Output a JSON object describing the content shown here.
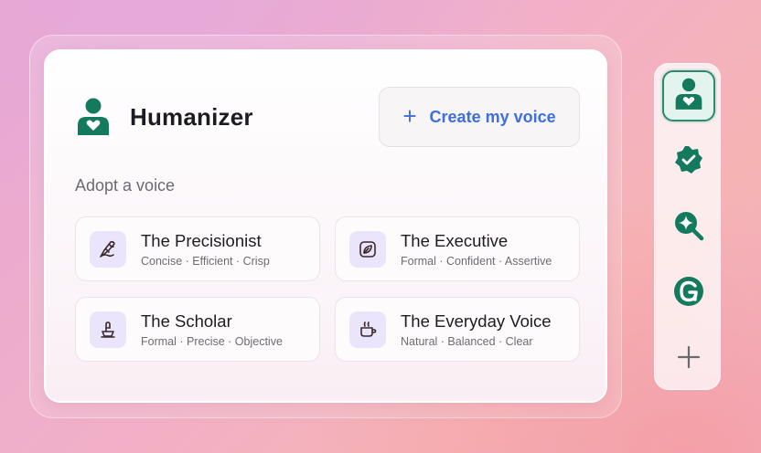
{
  "app": {
    "title": "Humanizer"
  },
  "create_button": {
    "label": "Create my voice"
  },
  "section": {
    "label": "Adopt a voice"
  },
  "voices": [
    {
      "title": "The Precisionist",
      "tags": "Concise · Efficient · Crisp",
      "icon": "pen-nib-icon"
    },
    {
      "title": "The Executive",
      "tags": "Formal · Confident · Assertive",
      "icon": "leaf-icon"
    },
    {
      "title": "The Scholar",
      "tags": "Formal · Precise · Objective",
      "icon": "quill-icon"
    },
    {
      "title": "The Everyday Voice",
      "tags": "Natural · Balanced · Clear",
      "icon": "coffee-cup-icon"
    }
  ],
  "sidebar": {
    "items": [
      {
        "icon": "humanizer-icon",
        "active": true
      },
      {
        "icon": "verified-badge-icon",
        "active": false
      },
      {
        "icon": "ai-search-icon",
        "active": false
      },
      {
        "icon": "grammarly-icon",
        "active": false
      },
      {
        "icon": "plus-icon",
        "active": false
      }
    ]
  },
  "colors": {
    "accent": "#3d6fe0",
    "brand": "#147a5e",
    "icon_bg": "#ebe5fb"
  }
}
